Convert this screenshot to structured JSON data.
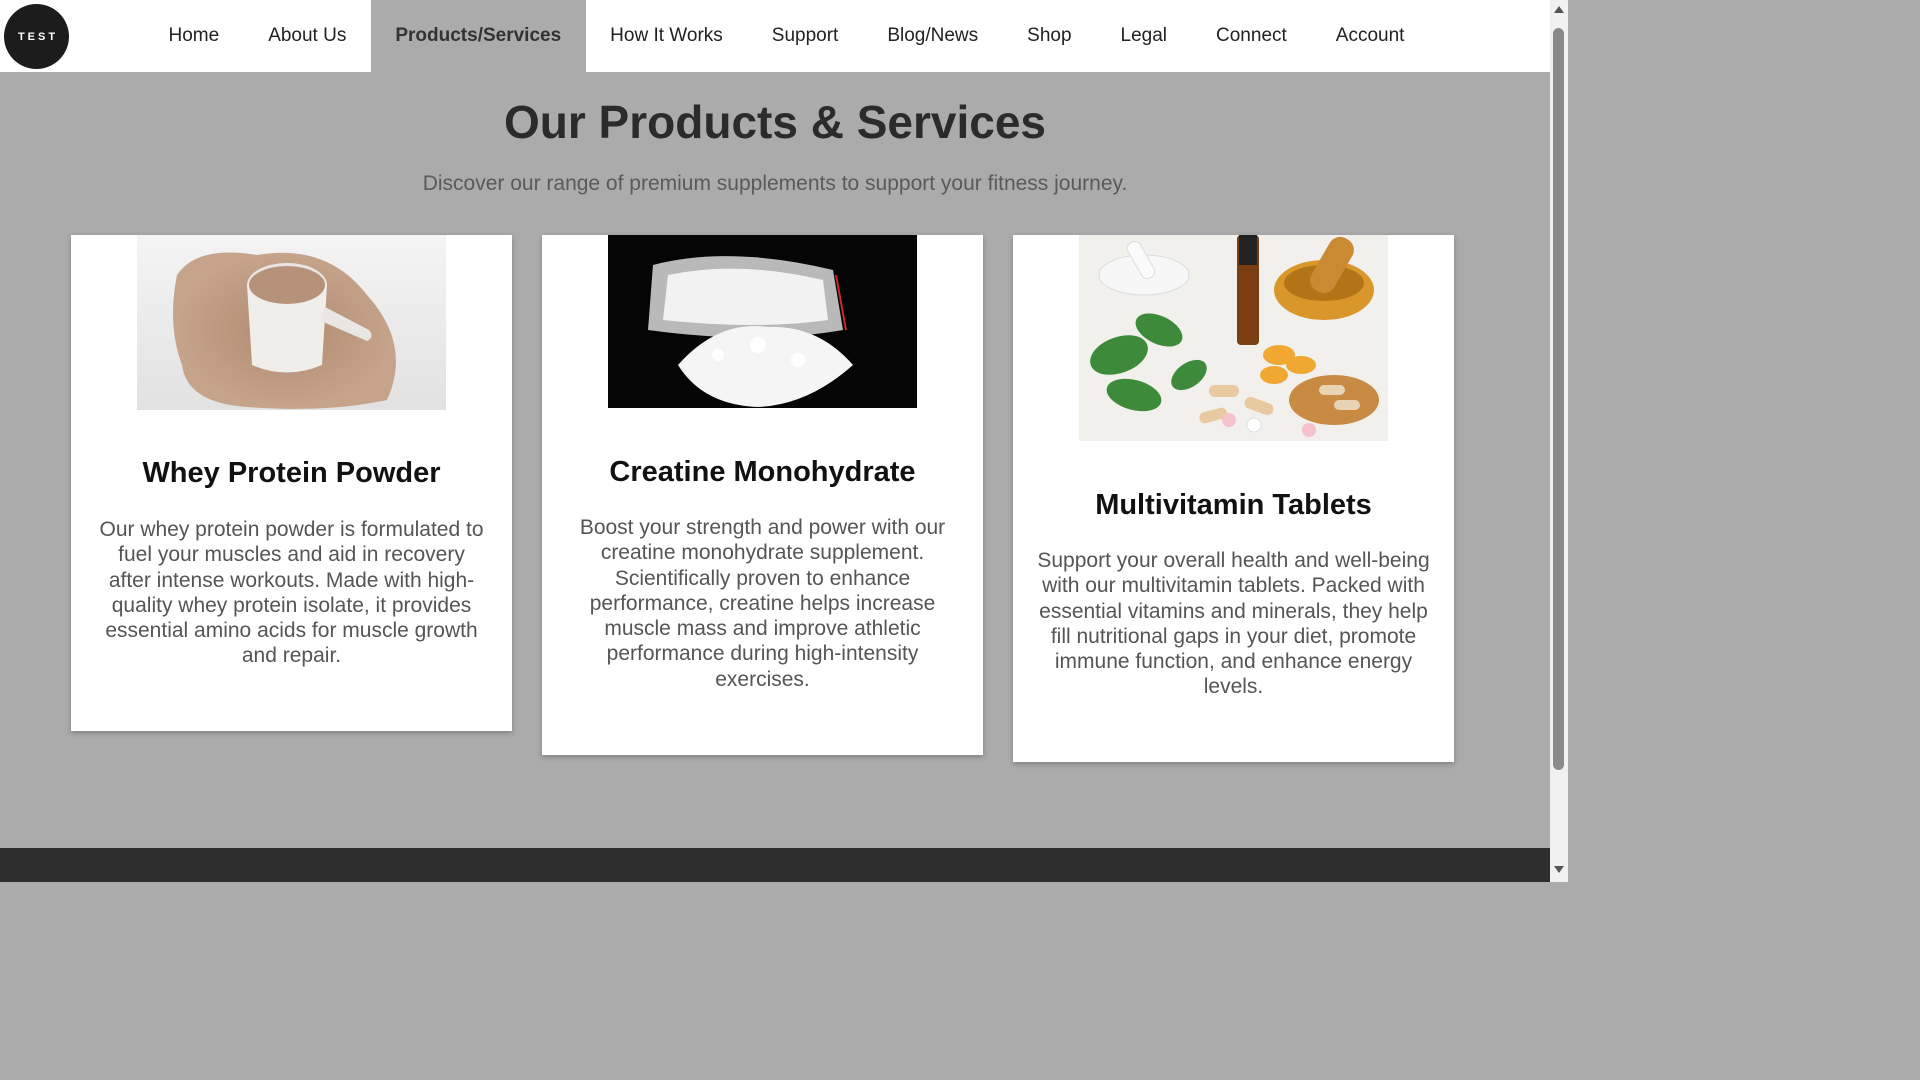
{
  "logo": {
    "text": "TEST"
  },
  "nav": {
    "items": [
      {
        "label": "Home"
      },
      {
        "label": "About Us"
      },
      {
        "label": "Products/Services",
        "active": true
      },
      {
        "label": "How It Works"
      },
      {
        "label": "Support"
      },
      {
        "label": "Blog/News"
      },
      {
        "label": "Shop"
      },
      {
        "label": "Legal"
      },
      {
        "label": "Connect"
      },
      {
        "label": "Account"
      }
    ]
  },
  "hero": {
    "title": "Our Products & Services",
    "subtitle": "Discover our range of premium supplements to support your fitness journey."
  },
  "products": [
    {
      "title": "Whey Protein Powder",
      "description": "Our whey protein powder is formulated to fuel your muscles and aid in recovery after intense workouts. Made with high-quality whey protein isolate, it provides essential amino acids for muscle growth and repair.",
      "image": "whey-protein-scoop-photo"
    },
    {
      "title": "Creatine Monohydrate",
      "description": "Boost your strength and power with our creatine monohydrate supplement. Scientifically proven to enhance performance, creatine helps increase muscle mass and improve athletic performance during high-intensity exercises.",
      "image": "creatine-powder-bag-photo"
    },
    {
      "title": "Multivitamin Tablets",
      "description": "Support your overall health and well-being with our multivitamin tablets. Packed with essential vitamins and minerals, they help fill nutritional gaps in your diet, promote immune function, and enhance energy levels.",
      "image": "vitamins-herbs-mortar-photo"
    }
  ],
  "colors": {
    "page_background": "#ababab",
    "header_background": "#ffffff",
    "active_nav_background": "#ababab",
    "footer_background": "#2e2e2e",
    "card_background": "#ffffff"
  }
}
